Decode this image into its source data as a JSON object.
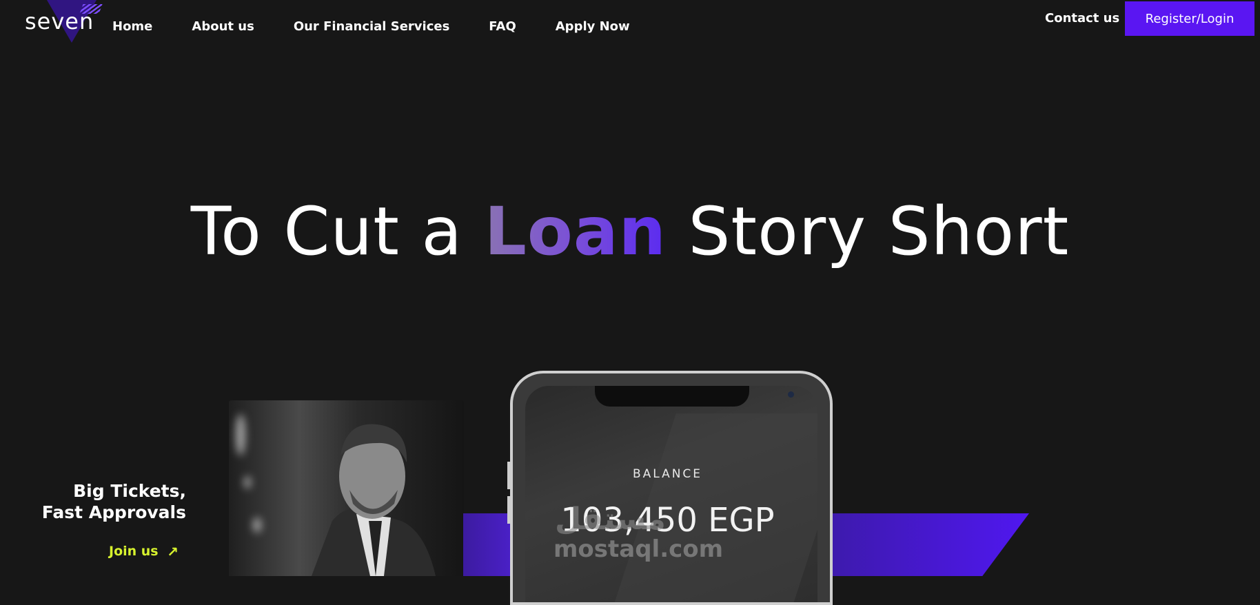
{
  "brand": {
    "logo_text": "seven",
    "accent": "#5a16f2",
    "highlight_gradient": [
      "#8a72b3",
      "#5b2bf0"
    ]
  },
  "nav": {
    "items": [
      "Home",
      "About us",
      "Our Financial Services",
      "FAQ",
      "Apply Now"
    ],
    "contact": "Contact us",
    "register": "Register/Login"
  },
  "hero": {
    "title_before": "To Cut a ",
    "title_highlight": "Loan",
    "title_after": " Story Short"
  },
  "promo": {
    "tagline_line1": "Big Tickets,",
    "tagline_line2": "Fast Approvals",
    "join_label": "Join us",
    "join_icon": "arrow-up-right-icon",
    "join_color": "#d7f22e"
  },
  "phone": {
    "balance_label": "BALANCE",
    "balance_amount": "103,450 EGP"
  },
  "watermark": {
    "text": "mostaql.com",
    "arabic": "مستقل"
  }
}
